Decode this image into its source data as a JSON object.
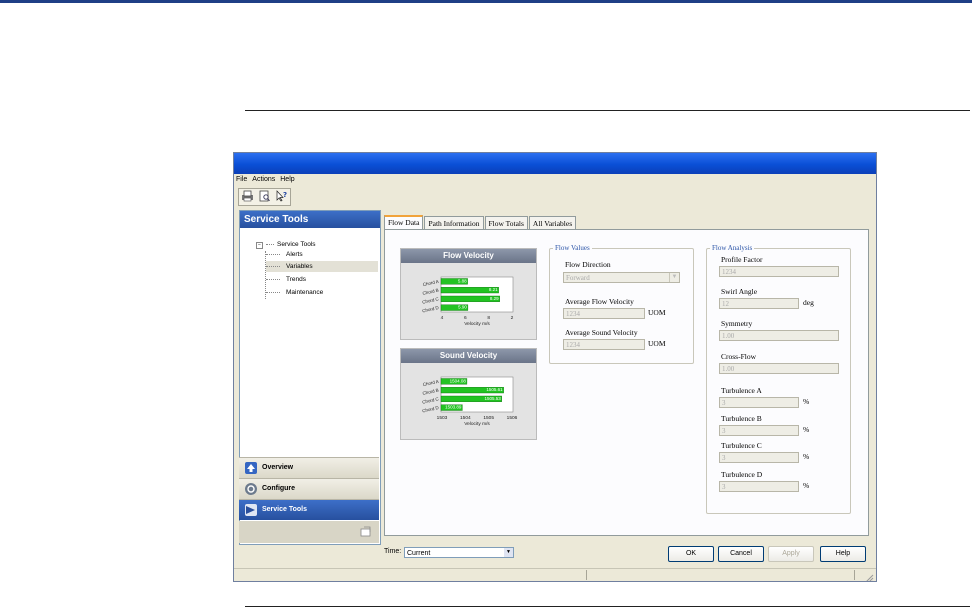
{
  "window": {
    "title": ""
  },
  "menu": [
    "File",
    "Actions",
    "Help"
  ],
  "toolbar": {
    "buttons": [
      "print-icon",
      "print-preview-icon",
      "help-pointer-icon"
    ]
  },
  "sidebar": {
    "header": "Service Tools",
    "tree": {
      "root": "Service Tools",
      "items": [
        "Alerts",
        "Variables",
        "Trends",
        "Maintenance"
      ],
      "selected": "Variables"
    },
    "nav": [
      {
        "label": "Overview",
        "icon": "arrow-up-icon"
      },
      {
        "label": "Configure",
        "icon": "gear-icon"
      },
      {
        "label": "Service Tools",
        "icon": "tools-icon"
      }
    ]
  },
  "tabs": [
    "Flow Data",
    "Path Information",
    "Flow Totals",
    "All Variables"
  ],
  "active_tab": "Flow Data",
  "charts": [
    {
      "title": "Flow Velocity",
      "chart_data": {
        "type": "bar",
        "orientation": "horizontal",
        "title": "Flow Velocity",
        "categories": [
          "Chord A",
          "Chord B",
          "Chord C",
          "Chord D"
        ],
        "values": [
          5.88,
          8.21,
          8.29,
          5.9
        ],
        "value_labels": [
          "5.88",
          "8.21",
          "8.29",
          "5.90"
        ],
        "xlabel": "Velocity m/s",
        "xticks": [
          "4",
          "6",
          "8",
          "2"
        ],
        "color": "#22c322"
      }
    },
    {
      "title": "Sound Velocity",
      "chart_data": {
        "type": "bar",
        "orientation": "horizontal",
        "title": "Sound Velocity",
        "categories": [
          "Chord A",
          "Chord B",
          "Chord C",
          "Chord D"
        ],
        "values": [
          1504.08,
          1505.61,
          1505.53,
          1503.89
        ],
        "value_labels": [
          "1504.08",
          "1505.61",
          "1505.53",
          "1503.89"
        ],
        "xlabel": "Velocity m/s",
        "xticks": [
          "1503",
          "1504",
          "1505",
          "1506"
        ],
        "xlim": [
          1503,
          1506
        ],
        "color": "#22c322"
      }
    }
  ],
  "flow_values": {
    "title": "Flow Values",
    "direction_label": "Flow Direction",
    "direction_value": "Forward",
    "avg_flow_label": "Average Flow Velocity",
    "avg_flow_value": "1234",
    "avg_flow_unit": "UOM",
    "avg_sound_label": "Average Sound Velocity",
    "avg_sound_value": "1234",
    "avg_sound_unit": "UOM"
  },
  "flow_analysis": {
    "title": "Flow Analysis",
    "fields": [
      {
        "label": "Profile Factor",
        "value": "1234",
        "unit": ""
      },
      {
        "label": "Swirl Angle",
        "value": "12",
        "unit": "deg"
      },
      {
        "label": "Symmetry",
        "value": "1.00",
        "unit": ""
      },
      {
        "label": "Cross-Flow",
        "value": "1.00",
        "unit": ""
      },
      {
        "label": "Turbulence A",
        "value": "3",
        "unit": "%"
      },
      {
        "label": "Turbulence B",
        "value": "3",
        "unit": "%"
      },
      {
        "label": "Turbulence C",
        "value": "3",
        "unit": "%"
      },
      {
        "label": "Turbulence D",
        "value": "3",
        "unit": "%"
      }
    ]
  },
  "footer": {
    "time_label": "Time:",
    "time_value": "Current",
    "ok": "OK",
    "cancel": "Cancel",
    "apply": "Apply",
    "help": "Help"
  }
}
